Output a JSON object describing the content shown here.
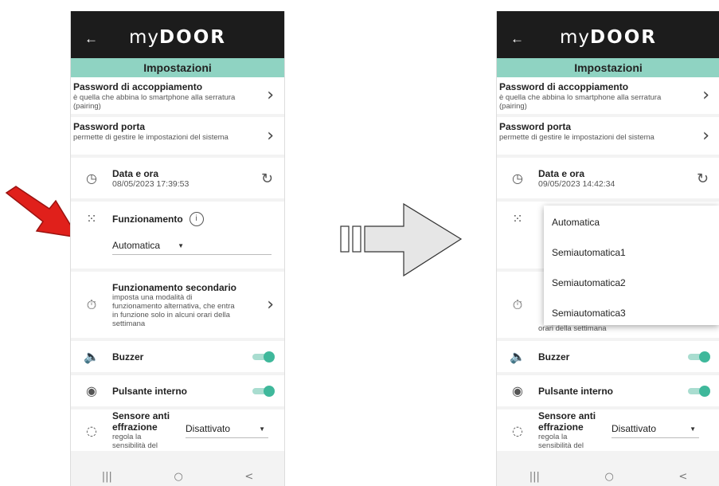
{
  "app": {
    "logo_prefix": "my",
    "logo_main": "DOOR",
    "back_icon": "arrow-left-icon"
  },
  "settings_title": "Impostazioni",
  "pairing_password": {
    "title": "Password di accoppiamento",
    "subtitle": "è quella che abbina lo smartphone alla serratura (pairing)"
  },
  "door_password": {
    "title": "Password porta",
    "subtitle": "permette di gestire le impostazioni del sistema"
  },
  "datetime": {
    "title": "Data e ora",
    "value_before": "08/05/2023 17:39:53",
    "value_after": "09/05/2023 14:42:34"
  },
  "operation": {
    "title": "Funzionamento",
    "selected": "Automatica"
  },
  "secondary_operation": {
    "title": "Funzionamento secondario",
    "subtitle": "imposta una modalità di funzionamento alternativa, che entra in funzione solo in alcuni orari della settimana",
    "partial_subtitle": "orari della settimana"
  },
  "buzzer": {
    "title": "Buzzer",
    "enabled": true
  },
  "internal_button": {
    "title": "Pulsante interno",
    "enabled": true
  },
  "anti_tamper": {
    "title_line1": "Sensore anti",
    "title_line2": "effrazione",
    "subtitle_line1": "regola la",
    "subtitle_line2": "sensibilità del",
    "value": "Disattivato"
  },
  "dropdown_options": [
    "Automatica",
    "Semiautomatica1",
    "Semiautomatica2",
    "Semiautomatica3"
  ],
  "nav": {
    "recents": "|||",
    "home": "○",
    "back": "<"
  },
  "colors": {
    "accent": "#8fd3c2",
    "toggle": "#3fb89b",
    "topbar": "#1c1c1c",
    "pointer_arrow": "#e0201b"
  }
}
